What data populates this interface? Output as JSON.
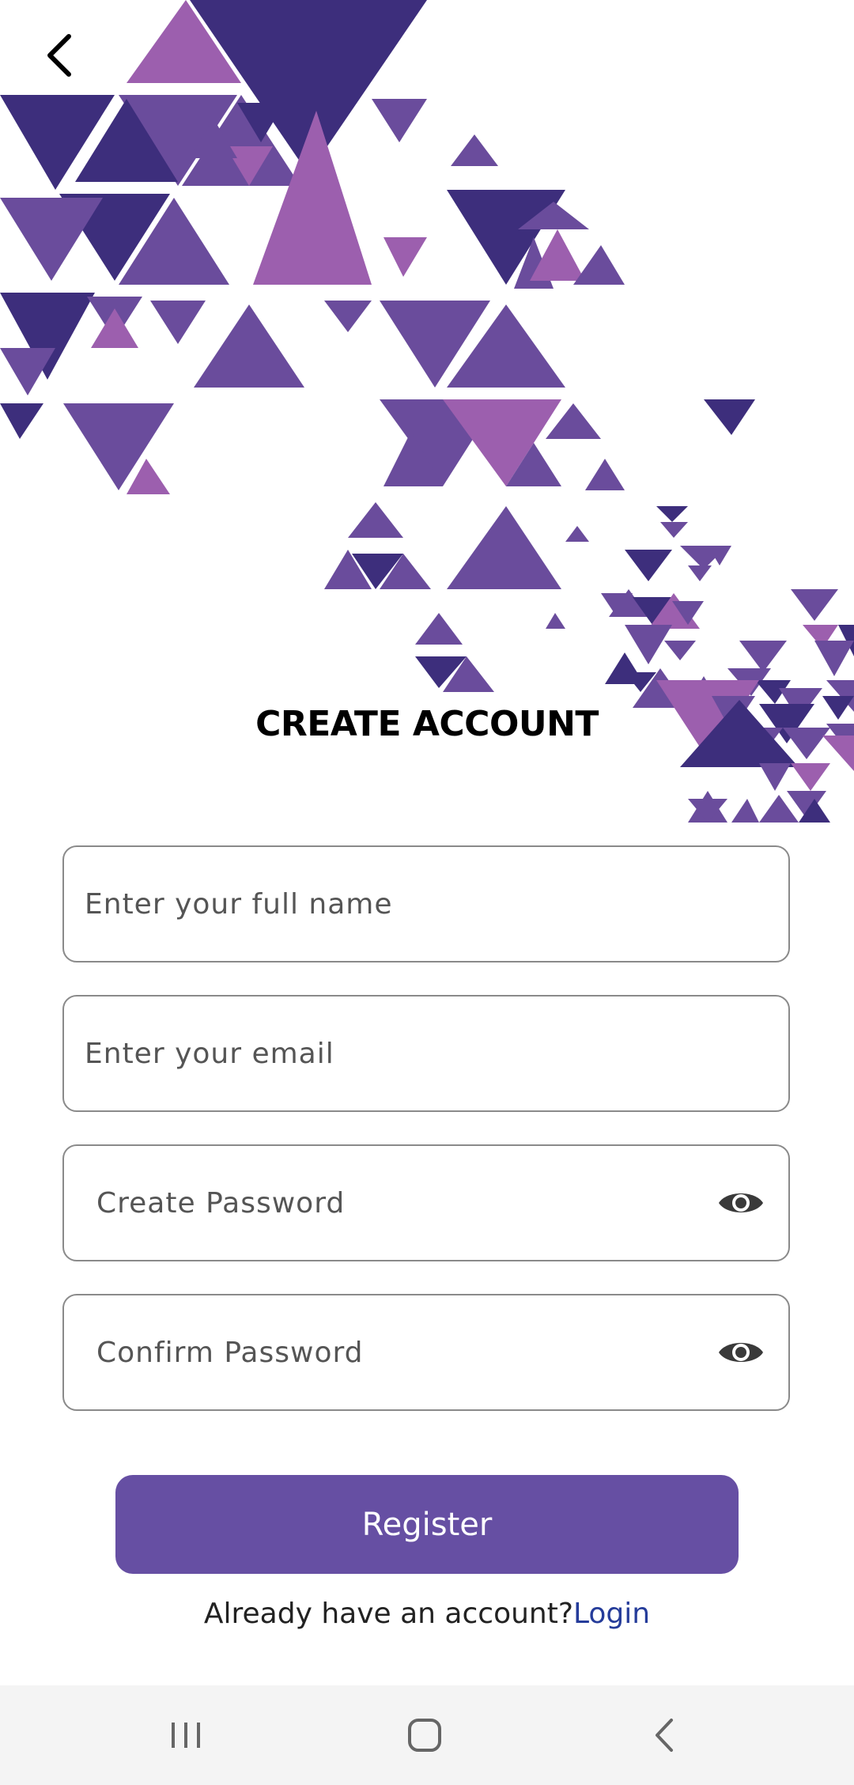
{
  "header": {
    "back_icon": "chevron-left-icon"
  },
  "title": "CREATE ACCOUNT",
  "form": {
    "full_name": {
      "placeholder": "Enter your full name",
      "value": ""
    },
    "email": {
      "placeholder": "Enter your email",
      "value": ""
    },
    "password": {
      "placeholder": "Create Password",
      "value": "",
      "toggle_icon": "eye-icon"
    },
    "confirm_password": {
      "placeholder": "Confirm Password",
      "value": "",
      "toggle_icon": "eye-icon"
    }
  },
  "register_button": {
    "label": "Register"
  },
  "login_prompt": {
    "text": "Already have an account?",
    "link": "Login"
  },
  "colors": {
    "primary": "#664fa3",
    "link": "#253c9a",
    "art_dark": "#3d2e7c",
    "art_mid": "#6a4c9c",
    "art_light": "#9c5fae",
    "navbar": "#f4f4f4"
  },
  "system_nav": {
    "recents_icon": "recents-icon",
    "home_icon": "home-icon",
    "back_icon": "system-back-icon"
  }
}
